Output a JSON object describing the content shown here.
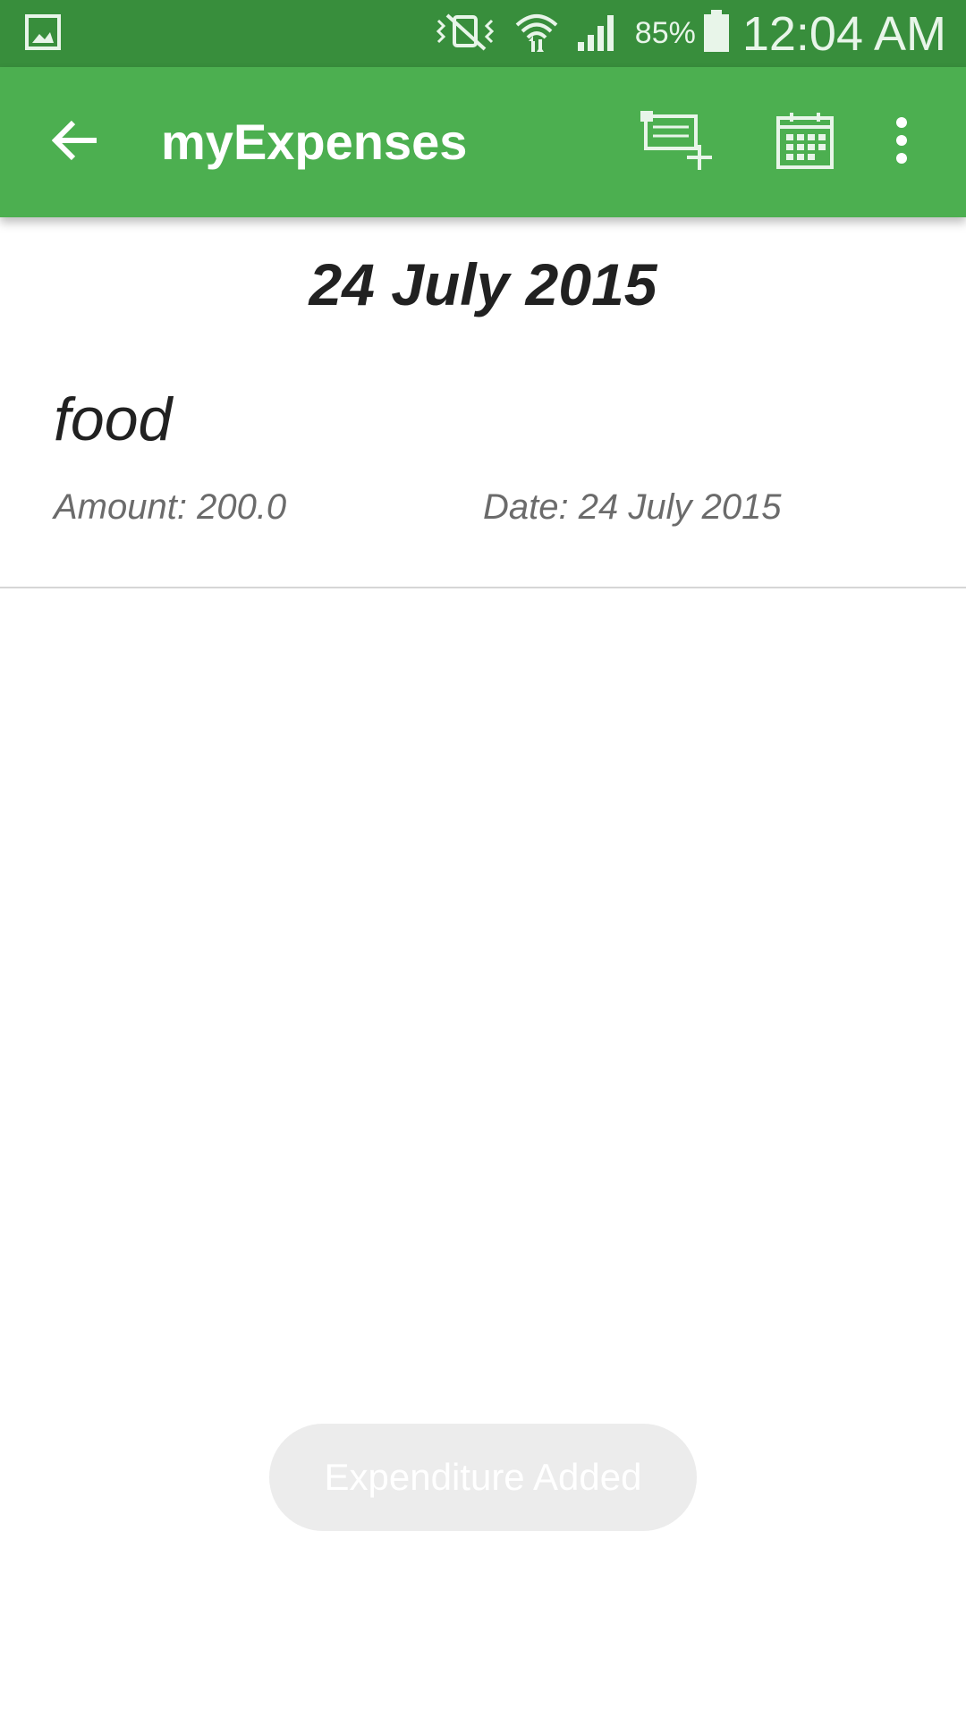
{
  "status_bar": {
    "battery": "85%",
    "time": "12:04 AM",
    "icons": [
      "gallery-notification-icon",
      "vibrate-off-icon",
      "wifi-icon",
      "cell-signal-icon",
      "battery-icon"
    ]
  },
  "app_bar": {
    "title": "myExpenses",
    "actions": [
      "back-arrow-icon",
      "add-expense-icon",
      "calendar-icon",
      "overflow-menu-icon"
    ]
  },
  "content": {
    "date_header": "24 July 2015",
    "expenses": [
      {
        "name": "food",
        "amount": "Amount: 200.0",
        "date": "Date: 24 July 2015"
      }
    ]
  },
  "toast": {
    "message": "Expenditure Added"
  },
  "colors": {
    "status_bar": "#388e3c",
    "app_bar": "#4caf50",
    "toast_bg": "#ececec"
  }
}
